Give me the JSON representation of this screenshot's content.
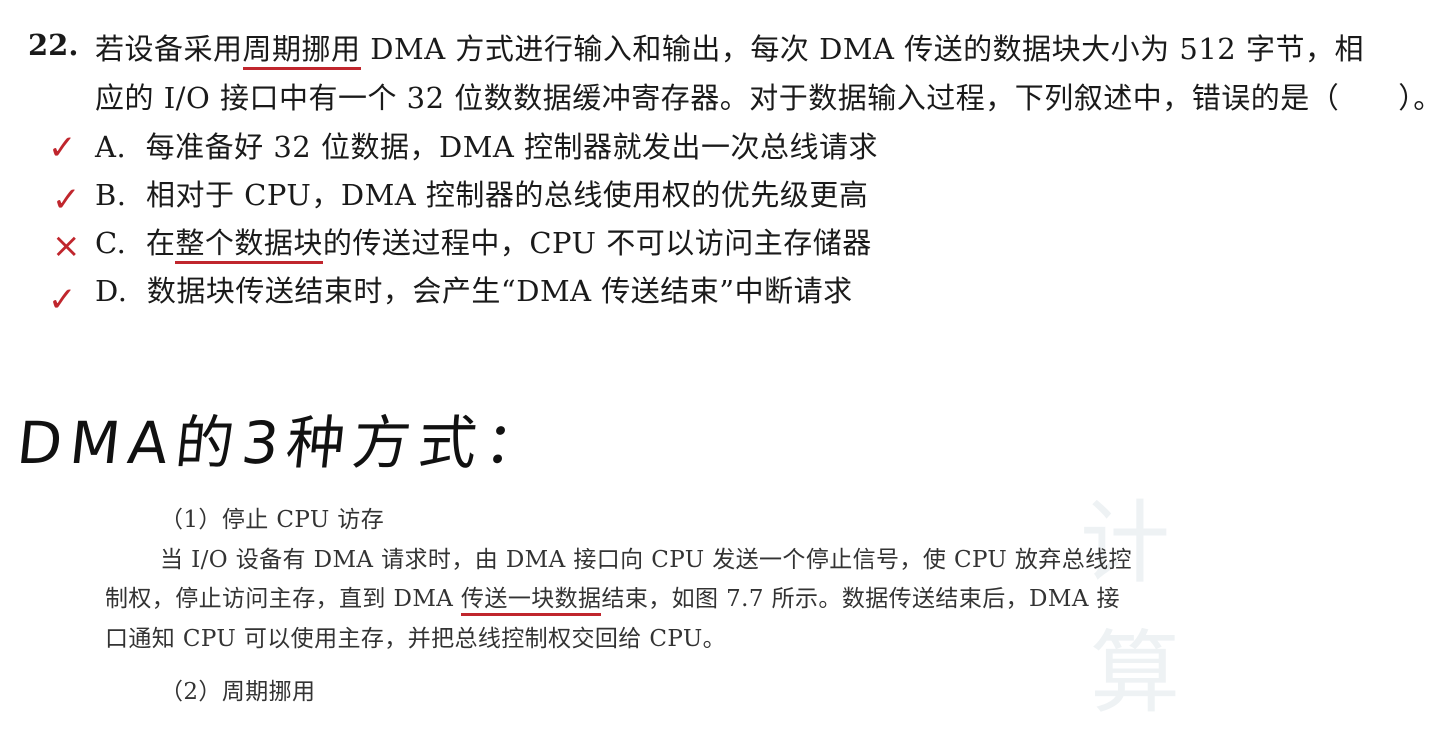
{
  "question": {
    "number": "22.",
    "line1_pre": "若设备采用",
    "line1_ul": "周期挪用",
    "line1_post": " DMA 方式进行输入和输出，每次 DMA 传送的数据块大小为 512 字节，相",
    "line2": "应的 I/O 接口中有一个 32 位数数据缓冲寄存器。对于数据输入过程，下列叙述中，错误的是（　　）。"
  },
  "options": [
    {
      "mark": "✓",
      "letter": "A.",
      "pre": "每准备好 32 位数据，DMA 控制器就发出一次总线请求",
      "ul": "",
      "post": ""
    },
    {
      "mark": "✓",
      "letter": "B.",
      "pre": "相对于 CPU，DMA 控制器的总线使用权的优先级更高",
      "ul": "",
      "post": ""
    },
    {
      "mark": "×",
      "letter": "C.",
      "pre": "在",
      "ul": "整个数据块",
      "post": "的传送过程中，CPU 不可以访问主存储器"
    },
    {
      "mark": "✓",
      "letter": "D.",
      "pre": "数据块传送结束时，会产生“DMA 传送结束”中断请求",
      "ul": "",
      "post": ""
    }
  ],
  "handwritten_heading": "DMA的3种方式：",
  "textbook": {
    "section_title": "（1）停止 CPU 访存",
    "para_line1": "当 I/O 设备有 DMA 请求时，由 DMA 接口向 CPU 发送一个停止信号，使 CPU 放弃总线控",
    "para_line2_pre": "制权，停止访问主存，直到 DMA ",
    "para_line2_ul": "传送一块数据",
    "para_line2_post": "结束，如图 7.7 所示。数据传送结束后，DMA 接",
    "para_line3": "口通知 CPU 可以使用主存，并把总线控制权交回给 CPU。",
    "next_section_partial": "（2）周期挪用"
  },
  "colors": {
    "annotation": "#c0262d",
    "text": "#1a1a1a"
  }
}
